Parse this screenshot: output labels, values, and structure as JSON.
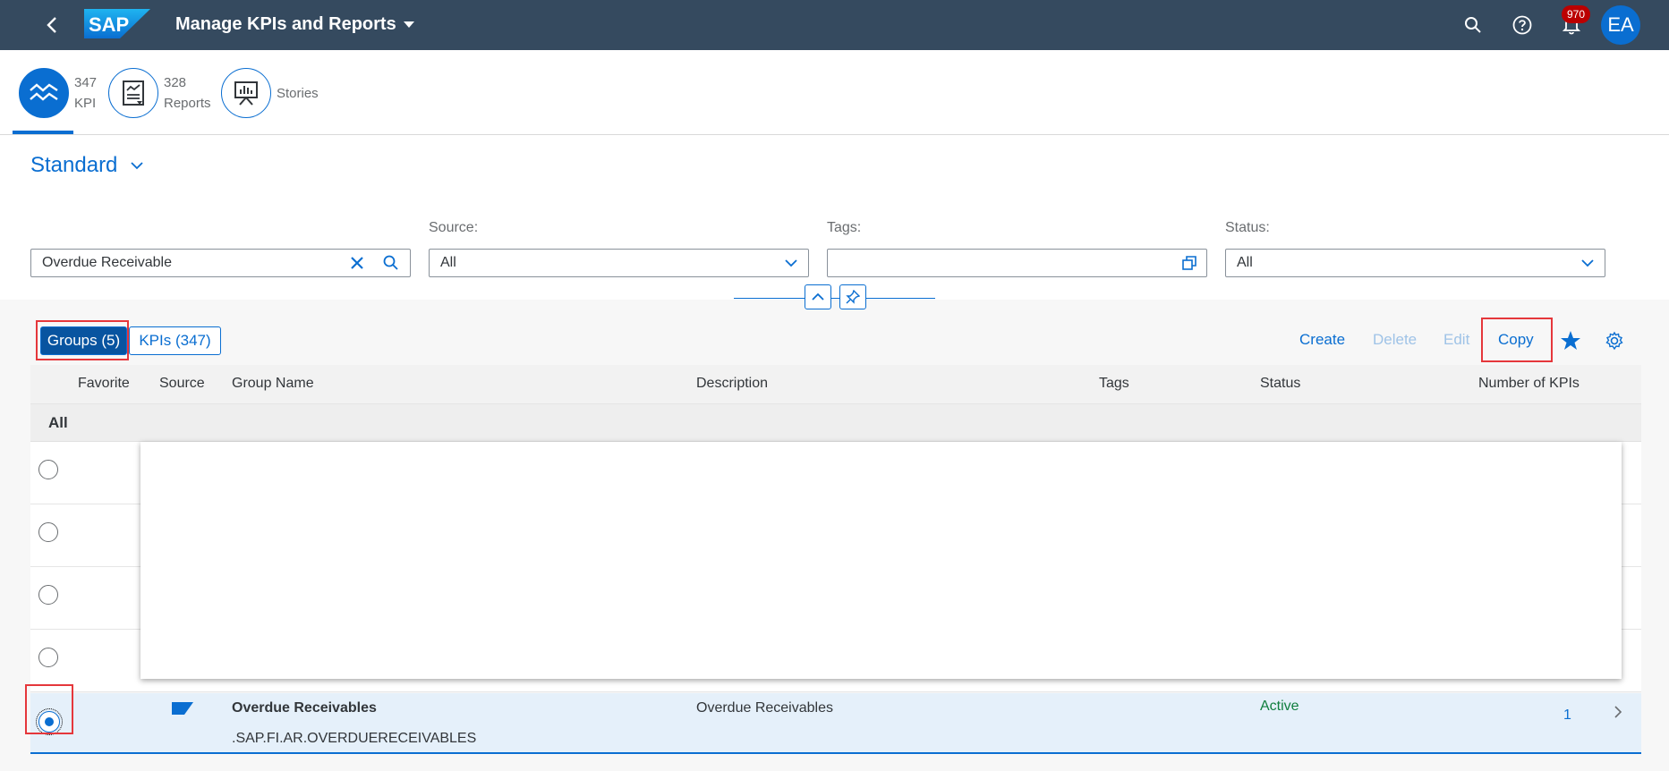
{
  "shell": {
    "logo_text": "SAP",
    "app_title": "Manage KPIs and Reports",
    "notification_count": "970",
    "avatar_initials": "EA",
    "colors": {
      "bar": "#354a5f",
      "accent": "#0a6ed1",
      "badge": "#bb0000"
    }
  },
  "icon_tabs": [
    {
      "count": "347",
      "label": "KPI",
      "icon": "kpi-line-chart-icon",
      "selected": true
    },
    {
      "count": "328",
      "label": "Reports",
      "icon": "report-icon",
      "selected": false
    },
    {
      "count": "",
      "label": "Stories",
      "icon": "presentation-board-icon",
      "selected": false
    }
  ],
  "filter_bar": {
    "variant_name": "Standard",
    "search_value": "Overdue Receivable",
    "source_label": "Source:",
    "source_value": "All",
    "tags_label": "Tags:",
    "tags_value": "",
    "status_label": "Status:",
    "status_value": "All"
  },
  "table_toolbar": {
    "groups_label": "Groups (5)",
    "kpis_label": "KPIs (347)",
    "create_label": "Create",
    "delete_label": "Delete",
    "edit_label": "Edit",
    "copy_label": "Copy"
  },
  "table": {
    "columns": [
      "Favorite",
      "Source",
      "Group Name",
      "Description",
      "Tags",
      "Status",
      "Number of KPIs"
    ],
    "group_header": "All",
    "selected_row": {
      "group_name": "Overdue Receivables",
      "group_id": ".SAP.FI.AR.OVERDUERECEIVABLES",
      "description": "Overdue Receivables",
      "tags": "",
      "status": "Active",
      "number_of_kpis": "1"
    },
    "status_active_color": "#107e3e"
  }
}
